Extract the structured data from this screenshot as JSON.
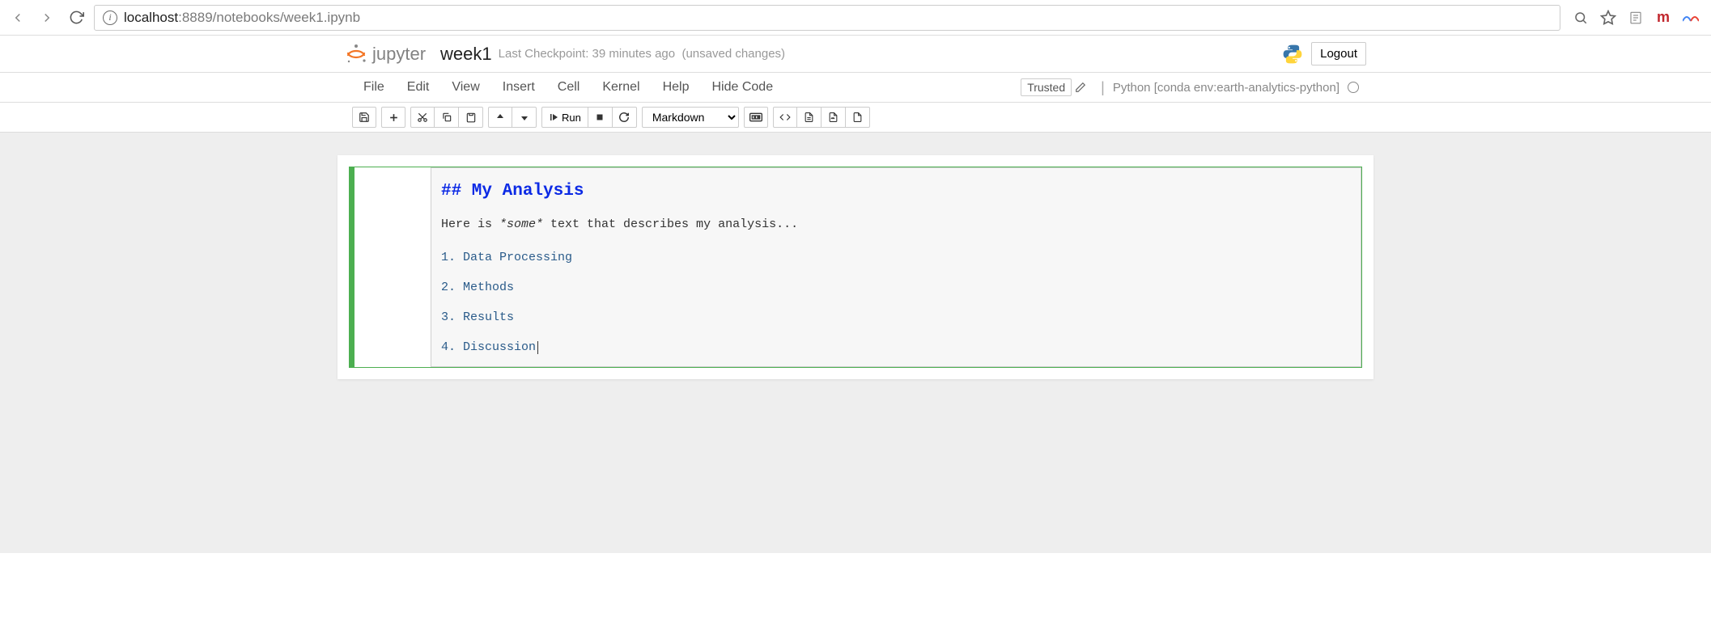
{
  "browser": {
    "url_host": "localhost",
    "url_rest": ":8889/notebooks/week1.ipynb"
  },
  "header": {
    "logo_text": "jupyter",
    "notebook_name": "week1",
    "checkpoint": "Last Checkpoint: 39 minutes ago",
    "unsaved": "(unsaved changes)",
    "logout": "Logout"
  },
  "menubar": {
    "items": [
      "File",
      "Edit",
      "View",
      "Insert",
      "Cell",
      "Kernel",
      "Help",
      "Hide Code"
    ],
    "trusted": "Trusted",
    "kernel": "Python [conda env:earth-analytics-python]"
  },
  "toolbar": {
    "run_label": "Run",
    "cell_type": "Markdown"
  },
  "cell": {
    "heading": "## My Analysis",
    "body_pre": "Here is ",
    "body_em": "*some*",
    "body_post": " text that describes my analysis...",
    "list": [
      "1. Data Processing",
      "2. Methods",
      "3. Results",
      "4. Discussion"
    ]
  }
}
